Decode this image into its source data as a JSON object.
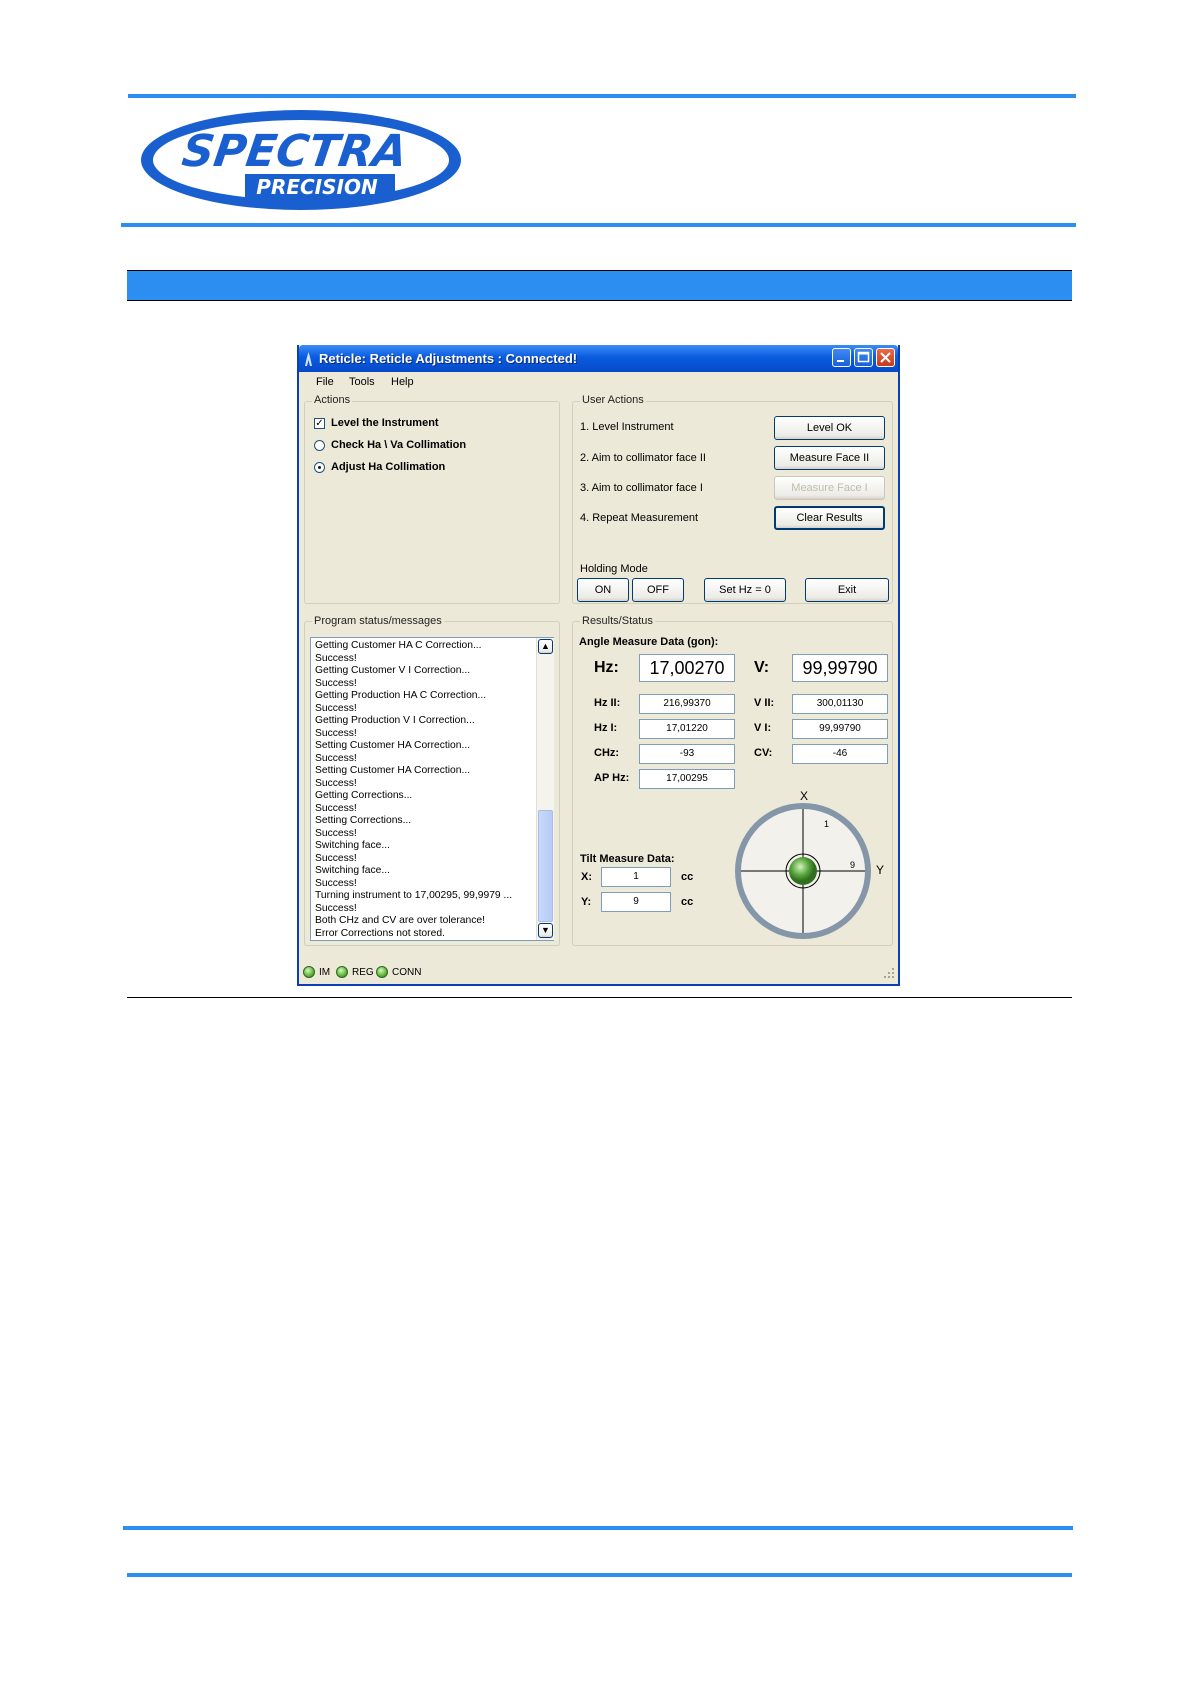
{
  "logo": {
    "line1": "SPECTRA",
    "line2": "PRECISION",
    "colors": {
      "primary": "#1a5fcf",
      "rule": "#2b8ef0"
    }
  },
  "window": {
    "title": "Reticle: Reticle Adjustments : Connected!",
    "title_icon": "instrument-icon",
    "menu": [
      "File",
      "Tools",
      "Help"
    ]
  },
  "actions": {
    "label": "Actions",
    "items": [
      {
        "label": "Level the Instrument",
        "kind": "checkbox",
        "checked": true
      },
      {
        "label": "Check Ha \\ Va Collimation",
        "kind": "radio",
        "checked": false
      },
      {
        "label": "Adjust Ha Collimation",
        "kind": "radio",
        "checked": true
      }
    ]
  },
  "user_actions": {
    "label": "User Actions",
    "steps": [
      {
        "text": "1.  Level Instrument",
        "button": "Level OK",
        "enabled": true
      },
      {
        "text": "2.  Aim to collimator face II",
        "button": "Measure Face II",
        "enabled": true
      },
      {
        "text": "3.  Aim to collimator face I",
        "button": "Measure Face I",
        "enabled": false
      },
      {
        "text": "4.  Repeat Measurement",
        "button": "Clear Results",
        "enabled": true
      }
    ],
    "holding_label": "Holding Mode",
    "buttons": {
      "on": "ON",
      "off": "OFF",
      "set_hz": "Set Hz = 0",
      "exit": "Exit"
    }
  },
  "status": {
    "label": "Program status/messages",
    "messages": [
      "Getting Customer HA C Correction...",
      "Success!",
      "Getting Customer V I Correction...",
      "Success!",
      "Getting Production HA C Correction...",
      "Success!",
      "Getting Production V I Correction...",
      "Success!",
      "Setting Customer HA Correction...",
      "Success!",
      "Setting Customer HA Correction...",
      "Success!",
      "Getting Corrections...",
      "Success!",
      "Setting Corrections...",
      "Success!",
      "Switching face...",
      "Success!",
      "Switching face...",
      "Success!",
      "Turning instrument to 17,00295, 99,9979 ...",
      "Success!",
      "Both CHz and CV are over tolerance!",
      "Error Corrections not stored."
    ]
  },
  "results": {
    "label": "Results/Status",
    "angle_label": "Angle Measure Data (gon):",
    "hz_label": "Hz:",
    "hz_value": "17,00270",
    "v_label": "V:",
    "v_value": "99,99790",
    "hz2_label": "Hz II:",
    "hz2_value": "216,99370",
    "v2_label": "V II:",
    "v2_value": "300,01130",
    "hz1_label": "Hz I:",
    "hz1_value": "17,01220",
    "v1_label": "V I:",
    "v1_value": "99,99790",
    "chz_label": "CHz:",
    "chz_value": "-93",
    "cv_label": "CV:",
    "cv_value": "-46",
    "aphz_label": "AP Hz:",
    "aphz_value": "17,00295",
    "tilt_label": "Tilt Measure Data:",
    "tilt_x_label": "X:",
    "tilt_x_value": "1",
    "tilt_x_unit": "cc",
    "tilt_y_label": "Y:",
    "tilt_y_value": "9",
    "tilt_y_unit": "cc",
    "bubble": {
      "axis_x": "X",
      "axis_y": "Y",
      "val_x": "1",
      "val_y": "9"
    }
  },
  "statusbar": {
    "items": [
      "IM",
      "REG",
      "CONN"
    ]
  }
}
